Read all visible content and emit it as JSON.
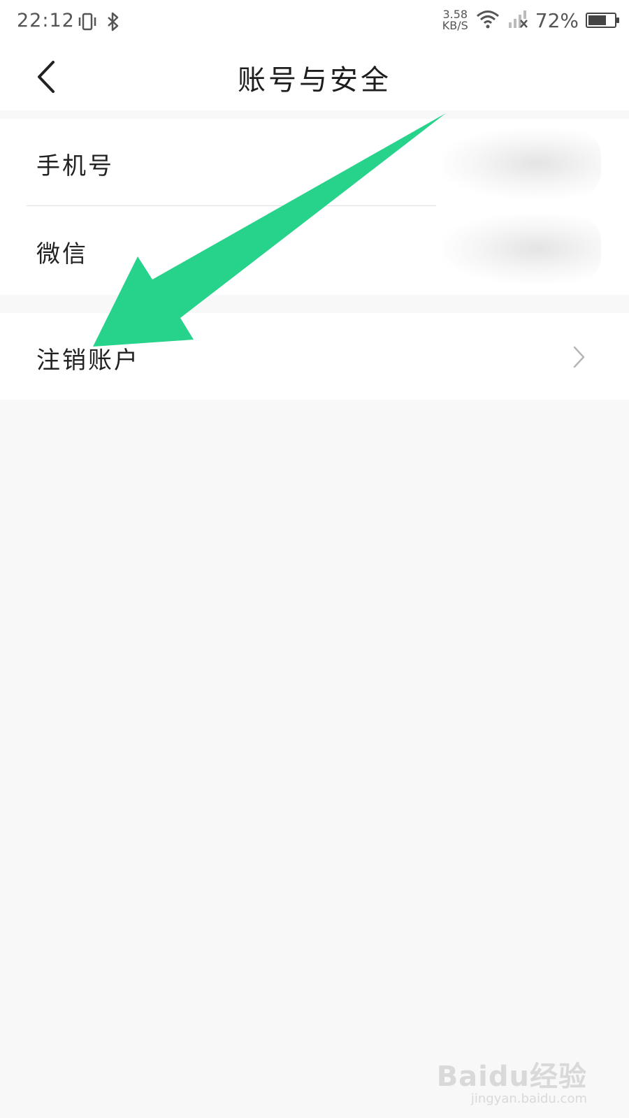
{
  "status_bar": {
    "time": "22:12",
    "net_speed_value": "3.58",
    "net_speed_unit": "KB/S",
    "battery_percent": "72%",
    "battery_level": 0.72,
    "icons": [
      "vibrate-icon",
      "bluetooth-icon",
      "wifi-icon",
      "signal-no-service-icon",
      "battery-icon"
    ]
  },
  "nav": {
    "title": "账号与安全",
    "back_icon": "chevron-left-icon"
  },
  "settings": {
    "group1": [
      {
        "label": "手机号"
      },
      {
        "label": "微信"
      }
    ],
    "group2": [
      {
        "label": "注销账户",
        "icon": "chevron-right-icon"
      }
    ]
  },
  "annotation": {
    "arrow_color": "#27d28b"
  },
  "watermark": {
    "brand": "Baidu经验",
    "url": "jingyan.baidu.com"
  },
  "colors": {
    "background": "#f8f8f8",
    "surface": "#ffffff",
    "text": "#222222",
    "arrow": "#27d28b"
  }
}
